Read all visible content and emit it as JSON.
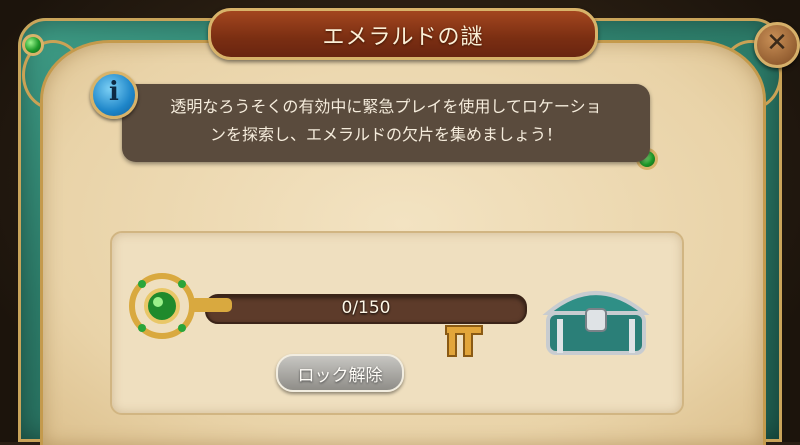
{
  "dialog": {
    "title": "エメラルドの謎",
    "close_icon": "close-icon",
    "info_icon": "info-icon",
    "info_icon_glyph": "i",
    "info_text_line1": "透明なろうそくの有効中に緊急プレイを使用してロケーショ",
    "info_text_line2": "ンを探索し、エメラルドの欠片を集めましょう！"
  },
  "progress": {
    "current": 0,
    "total": 150,
    "label": "0/150",
    "fill_fraction": 0,
    "key_icon": "emerald-key-icon",
    "marker_icon": "golden-marker-icon",
    "reward_icon": "treasure-chest-icon"
  },
  "actions": {
    "unlock_label": "ロック解除"
  },
  "colors": {
    "title_plate": "#8a3516",
    "frame_green": "#2d7d6a",
    "gold": "#d8b36a",
    "info_box": "#5a4b3d",
    "button_gray": "#a9a7a2"
  }
}
